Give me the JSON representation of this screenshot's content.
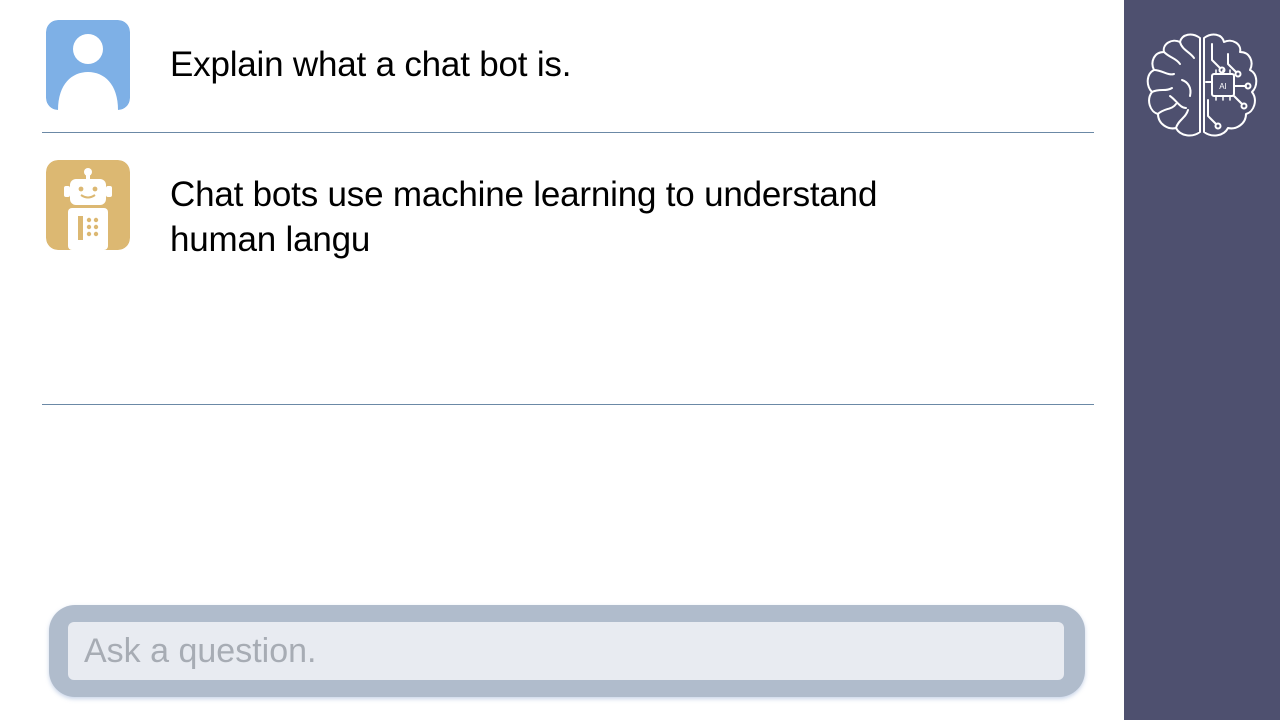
{
  "conversation": {
    "user_message": "Explain what a chat bot is.",
    "bot_message": "Chat bots use machine learning to understand human langu"
  },
  "input": {
    "placeholder": "Ask a question.",
    "value": ""
  },
  "sidebar": {
    "logo_icon": "brain-ai-icon",
    "logo_text": "AI"
  },
  "colors": {
    "sidebar_bg": "#4e506f",
    "user_avatar_bg": "#7eb0e6",
    "bot_avatar_bg": "#dcb872",
    "divider": "#6b89a6",
    "input_border": "#b0bccc",
    "input_bg": "#e8ebf1"
  }
}
